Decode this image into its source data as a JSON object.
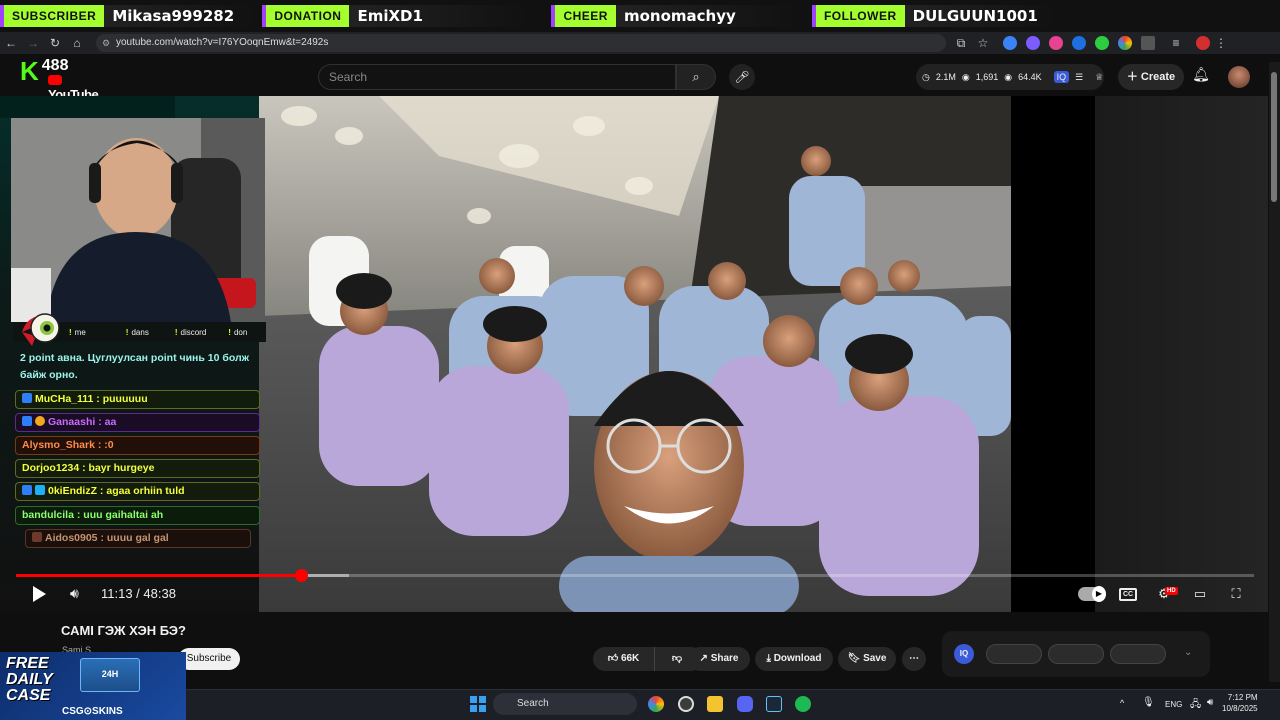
{
  "alerts": [
    {
      "tag": "SUBSCRIBER",
      "value": "Mikasa999282"
    },
    {
      "tag": "DONATION",
      "value": "EmiXD1"
    },
    {
      "tag": "CHEER",
      "value": "monomachyy"
    },
    {
      "tag": "FOLLOWER",
      "value": "DULGUUN1001"
    }
  ],
  "browser": {
    "url": "youtube.com/watch?v=I76YOoqnEmw&t=2492s"
  },
  "header": {
    "kick_count": "488",
    "yt_logo": "YouTube",
    "search_placeholder": "Search",
    "stats": {
      "views": "2.1M",
      "a": "1,691",
      "b": "64.4K"
    },
    "create_label": "Create"
  },
  "stream": {
    "chat_tabs": [
      "me",
      "dans",
      "discord",
      "don"
    ],
    "first_message": "2 point авна. Цуглуулсан point чинь 10 болж байж орно.",
    "messages": [
      {
        "user": "MuCHa_111",
        "text": "puuuuuu"
      },
      {
        "user": "Ganaashi",
        "text": "aa"
      },
      {
        "user": "Alysmo_Shark",
        "text": ":0"
      },
      {
        "user": "Dorjoo1234",
        "text": "bayr hurgeye"
      },
      {
        "user": "0kiEndizZ",
        "text": "agaa orhiin tuld"
      },
      {
        "user": "bandulcila",
        "text": "uuu gaihaltai ah"
      },
      {
        "user": "Aidos0905",
        "text": "uuuu gal gal"
      }
    ]
  },
  "player": {
    "time": "11:13 / 48:38",
    "progress_fraction": 0.23,
    "buffer_fraction": 0.269,
    "hd_badge": "HD",
    "cc": "CC"
  },
  "video": {
    "title": "САМІ ГЭЖ ХЭН БЭ?",
    "channel": "Sami S",
    "subscribe_label": "Subscribe",
    "likes": "66K",
    "share_label": "Share",
    "download_label": "Download",
    "save_label": "Save",
    "iq_label": "IQ"
  },
  "ad": {
    "line1": "FREE",
    "line2": "DAILY",
    "line3": "CASE",
    "brand": "CSG⊙SKINS",
    "box_text": "24H"
  },
  "taskbar": {
    "search": "Search",
    "lang": "ENG",
    "time": "7:12 PM",
    "date": "10/8/2025"
  }
}
